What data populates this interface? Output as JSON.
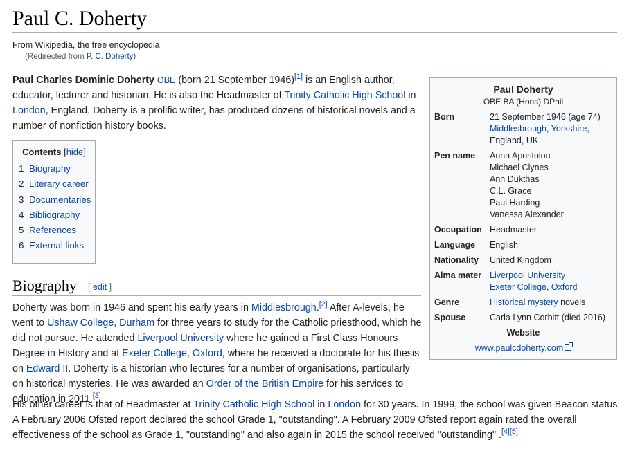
{
  "article": {
    "title": "Paul C. Doherty",
    "tagline": "From Wikipedia, the free encyclopedia",
    "redirect_prefix": "(Redirected from ",
    "redirect_link": "P. C. Doherty",
    "redirect_suffix": ")"
  },
  "lead": {
    "name": "Paul Charles Dominic Doherty",
    "postnominal": "OBE",
    "t1": " (born 21 September 1946)",
    "ref1": "[1]",
    "t2": " is an English author, educator, lecturer and historian. He is also the Headmaster of ",
    "link_school": "Trinity Catholic High School",
    "t3": " in ",
    "link_london": "London",
    "t4": ", England. Doherty is a prolific writer, has produced dozens of historical novels and a number of nonfiction history books."
  },
  "toc": {
    "title": "Contents",
    "hide_open": " [",
    "hide": "hide",
    "hide_close": "]",
    "items": [
      {
        "num": "1",
        "label": "Biography"
      },
      {
        "num": "2",
        "label": "Literary career"
      },
      {
        "num": "3",
        "label": "Documentaries"
      },
      {
        "num": "4",
        "label": "Bibliography"
      },
      {
        "num": "5",
        "label": "References"
      },
      {
        "num": "6",
        "label": "External links"
      }
    ]
  },
  "biography": {
    "heading": "Biography",
    "edit_open": "[ ",
    "edit": "edit",
    "edit_close": " ]",
    "p1": {
      "a": "Doherty was born in 1946 and spent his early years in ",
      "l1": "Middlesbrough",
      "b": ".",
      "ref2": "[2]",
      "c": " After A-levels, he went to ",
      "l2": "Ushaw College, Durham",
      "d": " for three years to study for the Catholic priesthood, which he did not pursue. He attended ",
      "l3": "Liverpool University",
      "e": " where he gained a First Class Honours Degree in History and at ",
      "l4": "Exeter College, Oxford",
      "f": ", where he received a doctorate for his thesis on ",
      "l5": "Edward II",
      "g": ". Doherty is a historian who lectures for a number of organisations, particularly on historical mysteries. He was awarded an ",
      "l6": "Order of the British Empire",
      "h": " for his services to education in 2011.",
      "ref3": "[3]"
    },
    "p2": {
      "a": "His other career is that of Headmaster at ",
      "l1": "Trinity Catholic High School",
      "b": " in ",
      "l2": "London",
      "c": " for 30 years. In 1999, the school was given Beacon status. A February 2006 Ofsted report declared the school Grade 1, \"outstanding\". A February 2009 Ofsted report again rated the overall effectiveness of the school as Grade 1, \"outstanding\" and also again in 2015 the school received \"outstanding\" .",
      "ref4": "[4]",
      "ref5": "[5]"
    }
  },
  "infobox": {
    "name": "Paul Doherty",
    "postnominals": "OBE BA (Hons) DPhil",
    "born": {
      "label": "Born",
      "date": "21 September 1946 (age 74)",
      "place1": "Middlesbrough",
      "sep": ", ",
      "place2": "Yorkshire",
      "place_end": ",",
      "country": "England, UK"
    },
    "pen_name": {
      "label": "Pen name",
      "values": [
        "Anna Apostolou",
        "Michael Clynes",
        "Ann Dukthas",
        "C.L. Grace",
        "Paul Harding",
        "Vanessa Alexander"
      ]
    },
    "occupation": {
      "label": "Occupation",
      "value": "Headmaster"
    },
    "language": {
      "label": "Language",
      "value": "English"
    },
    "nationality": {
      "label": "Nationality",
      "value": "United Kingdom"
    },
    "alma_mater": {
      "label": "Alma mater",
      "values": [
        "Liverpool University",
        "Exeter College, Oxford"
      ]
    },
    "genre": {
      "label": "Genre",
      "link": "Historical mystery",
      "rest": " novels"
    },
    "spouse": {
      "label": "Spouse",
      "value": "Carla Lynn Corbitt (died 2016)"
    },
    "website": {
      "label": "Website",
      "value": "www.paulcdoherty.com"
    }
  },
  "colors": {
    "link": "#0645ad",
    "text": "#222222",
    "rule": "#a2a9b1",
    "box_bg": "#f8f9fa"
  }
}
